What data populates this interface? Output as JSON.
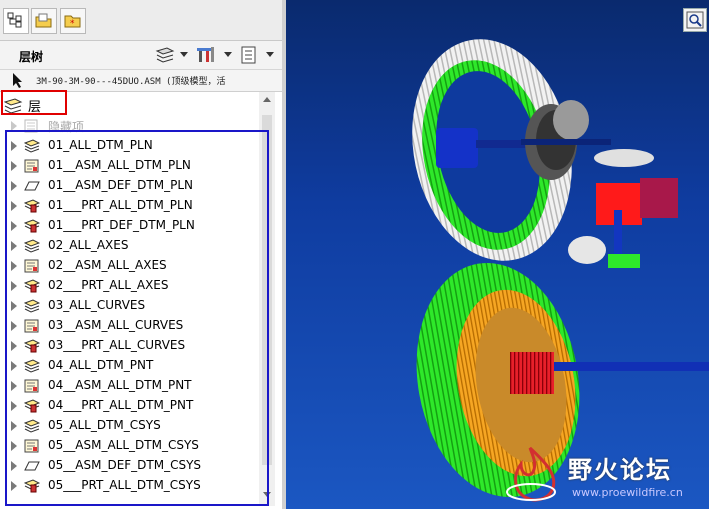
{
  "panel": {
    "title": "层树",
    "path": "3M-90-3M-90---45DUO.ASM (顶级模型，活"
  },
  "tree": {
    "root_label": "层",
    "hidden_item": "隐藏项",
    "layers": [
      {
        "name": "01_ALL_DTM_PLN",
        "icon": "layer-stack-icon"
      },
      {
        "name": "01__ASM_ALL_DTM_PLN",
        "icon": "layer-rule-icon"
      },
      {
        "name": "01__ASM_DEF_DTM_PLN",
        "icon": "plane-icon"
      },
      {
        "name": "01___PRT_ALL_DTM_PLN",
        "icon": "layer-part-icon"
      },
      {
        "name": "01___PRT_DEF_DTM_PLN",
        "icon": "layer-part-icon"
      },
      {
        "name": "02_ALL_AXES",
        "icon": "layer-stack-icon"
      },
      {
        "name": "02__ASM_ALL_AXES",
        "icon": "layer-rule-icon"
      },
      {
        "name": "02___PRT_ALL_AXES",
        "icon": "layer-part-icon"
      },
      {
        "name": "03_ALL_CURVES",
        "icon": "layer-stack-icon"
      },
      {
        "name": "03__ASM_ALL_CURVES",
        "icon": "layer-rule-icon"
      },
      {
        "name": "03___PRT_ALL_CURVES",
        "icon": "layer-part-icon"
      },
      {
        "name": "04_ALL_DTM_PNT",
        "icon": "layer-stack-icon"
      },
      {
        "name": "04__ASM_ALL_DTM_PNT",
        "icon": "layer-rule-icon"
      },
      {
        "name": "04___PRT_ALL_DTM_PNT",
        "icon": "layer-part-icon"
      },
      {
        "name": "05_ALL_DTM_CSYS",
        "icon": "layer-stack-icon"
      },
      {
        "name": "05__ASM_ALL_DTM_CSYS",
        "icon": "layer-rule-icon"
      },
      {
        "name": "05__ASM_DEF_DTM_CSYS",
        "icon": "plane-icon"
      },
      {
        "name": "05___PRT_ALL_DTM_CSYS",
        "icon": "layer-part-icon"
      }
    ]
  },
  "watermark": {
    "title": "野火论坛",
    "url": "www.proewildfire.cn"
  },
  "colors": {
    "red_highlight": "#e00000",
    "blue_highlight": "#1a17c8",
    "viewport_bg": "#0f3ca0",
    "gear_green": "#22e01e"
  }
}
